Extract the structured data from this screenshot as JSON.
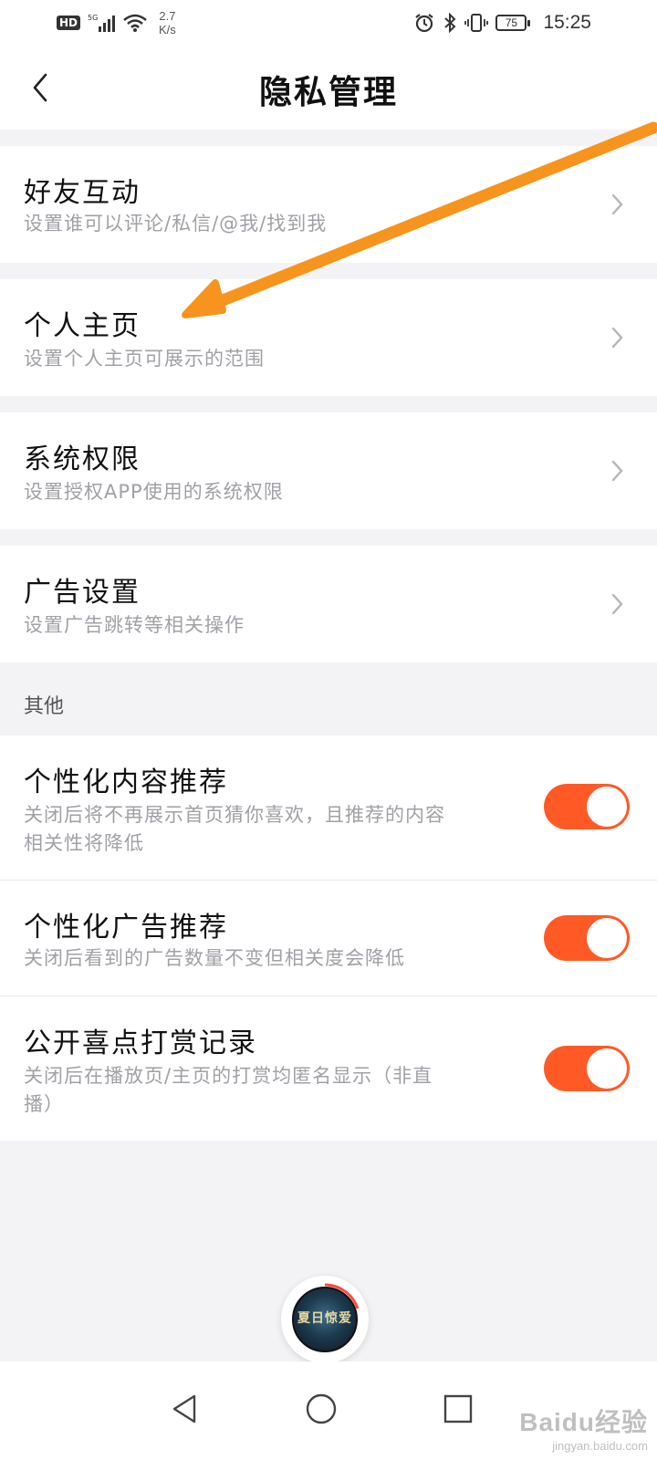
{
  "status_bar": {
    "hd": "HD",
    "network": "5G",
    "speed_value": "2.7",
    "speed_unit": "K/s",
    "battery": "75",
    "time": "15:25"
  },
  "header": {
    "title": "隐私管理",
    "back_icon": "chevron-left-icon"
  },
  "settings": [
    {
      "title": "好友互动",
      "subtitle": "设置谁可以评论/私信/@我/找到我"
    },
    {
      "title": "个人主页",
      "subtitle": "设置个人主页可展示的范围"
    },
    {
      "title": "系统权限",
      "subtitle": "设置授权APP使用的系统权限"
    },
    {
      "title": "广告设置",
      "subtitle": "设置广告跳转等相关操作"
    }
  ],
  "other_section": {
    "label": "其他",
    "toggles": [
      {
        "title": "个性化内容推荐",
        "desc_line1": "关闭后将不再展示首页猜你喜欢，且推荐的内容",
        "desc_line2": "相关性将降低",
        "on": true
      },
      {
        "title": "个性化广告推荐",
        "desc_line1": "关闭后看到的广告数量不变但相关度会降低",
        "desc_line2": "",
        "on": true
      },
      {
        "title": "公开喜点打赏记录",
        "desc_line1": "关闭后在播放页/主页的打赏均匿名显示（非直",
        "desc_line2": "播）",
        "on": true
      }
    ]
  },
  "player": {
    "cover_text": "夏日惊爱"
  },
  "system_nav": {
    "back": "triangle-back-icon",
    "home": "circle-home-icon",
    "recents": "square-recents-icon"
  },
  "watermark": {
    "main": "Baidu经验",
    "sub": "jingyan.baidu.com"
  },
  "colors": {
    "accent": "#ff5a26",
    "annotation_arrow": "#f7941d"
  }
}
